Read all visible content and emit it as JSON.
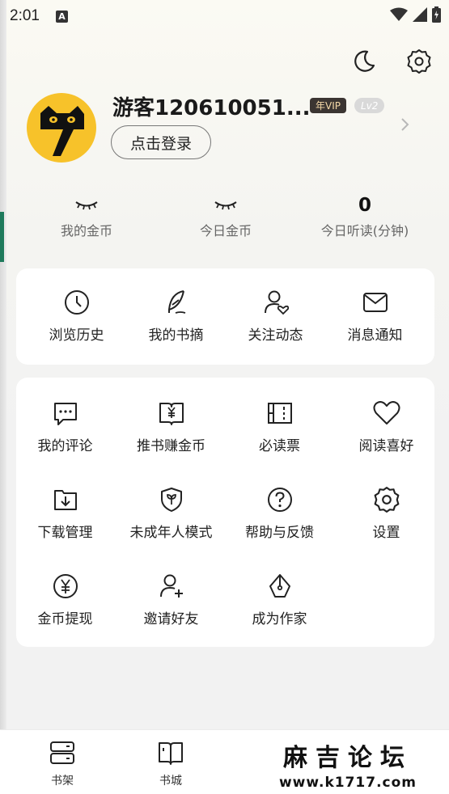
{
  "status_bar": {
    "time": "2:01",
    "notification_letter": "A"
  },
  "profile": {
    "username": "游客120610051...",
    "vip_badge": "年VIP",
    "level_badge": "Lv2",
    "login_button": "点击登录"
  },
  "stats": [
    {
      "value": "",
      "label": "我的金币"
    },
    {
      "value": "",
      "label": "今日金币"
    },
    {
      "value": "0",
      "label": "今日听读(分钟)"
    }
  ],
  "quick_menu": [
    {
      "label": "浏览历史",
      "icon": "clock-icon"
    },
    {
      "label": "我的书摘",
      "icon": "feather-icon"
    },
    {
      "label": "关注动态",
      "icon": "user-heart-icon"
    },
    {
      "label": "消息通知",
      "icon": "mail-icon"
    }
  ],
  "services": [
    {
      "label": "我的评论",
      "icon": "comment-icon"
    },
    {
      "label": "推书赚金币",
      "icon": "book-yen-icon"
    },
    {
      "label": "必读票",
      "icon": "ticket-icon"
    },
    {
      "label": "阅读喜好",
      "icon": "heart-icon"
    },
    {
      "label": "下载管理",
      "icon": "download-icon"
    },
    {
      "label": "未成年人模式",
      "icon": "shield-leaf-icon"
    },
    {
      "label": "帮助与反馈",
      "icon": "help-icon"
    },
    {
      "label": "设置",
      "icon": "settings-icon"
    },
    {
      "label": "金币提现",
      "icon": "coin-yen-icon"
    },
    {
      "label": "邀请好友",
      "icon": "user-add-icon"
    },
    {
      "label": "成为作家",
      "icon": "pen-nib-icon"
    }
  ],
  "bottom_nav": [
    {
      "label": "书架",
      "icon": "bookshelf-icon"
    },
    {
      "label": "书城",
      "icon": "book-open-icon"
    }
  ],
  "watermark": {
    "title": "麻吉论坛",
    "url": "www.k1717.com"
  },
  "colors": {
    "avatar_bg": "#f7c22a",
    "vip_bg": "#3b3532",
    "vip_text": "#f5d9a8",
    "card_bg": "#ffffff"
  }
}
